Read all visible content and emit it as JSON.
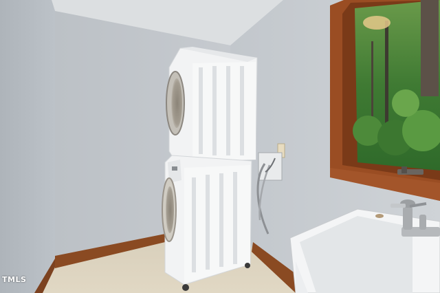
{
  "photo": {
    "watermark": "TMLS",
    "icons": [
      "stacked-washer-dryer",
      "utility-sink",
      "faucet",
      "window",
      "electrical-outlet"
    ],
    "colors": {
      "wall_left": "#b9bfc5",
      "wall_center": "#c3c8cd",
      "wall_right": "#c9ced3",
      "ceiling": "#dcdfe1",
      "floor": "#d6cdb9",
      "baseboard": "#8a4a22",
      "window_frame": "#9a4d23",
      "foliage": "#3f7a33",
      "appliance": "#f2f3f4",
      "sink": "#f4f5f6"
    }
  }
}
